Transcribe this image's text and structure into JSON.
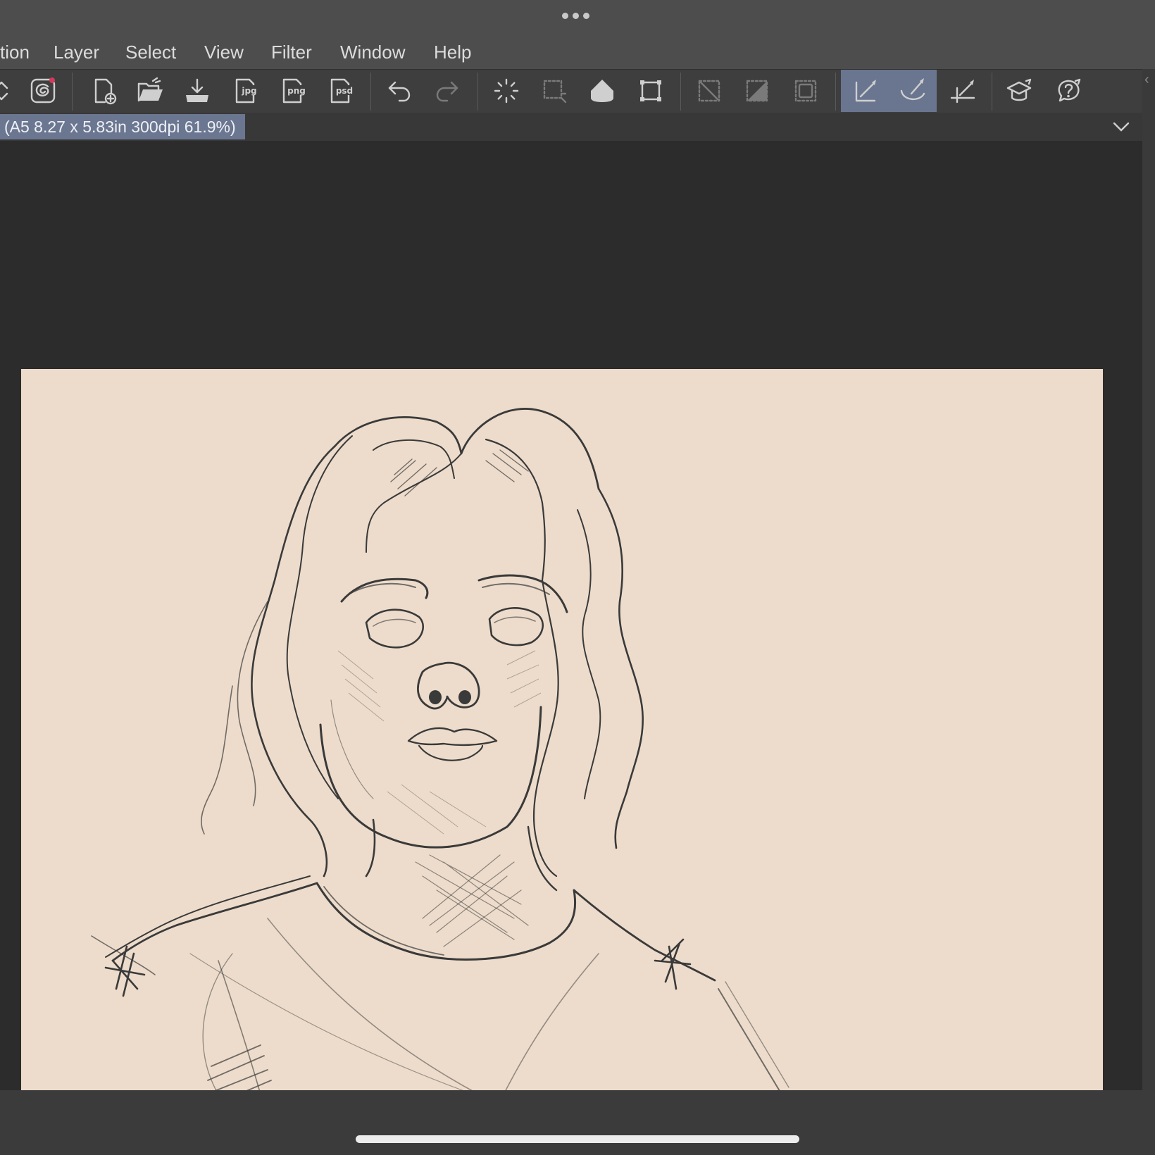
{
  "menu": {
    "items": [
      "tion",
      "Layer",
      "Select",
      "View",
      "Filter",
      "Window",
      "Help"
    ]
  },
  "toolbar": {
    "tools": [
      {
        "name": "scroll-arrows-icon",
        "state": "normal"
      },
      {
        "name": "app-logo-icon",
        "state": "normal",
        "has_notification_dot": true
      },
      {
        "name": "new-file-icon",
        "state": "normal"
      },
      {
        "name": "open-folder-icon",
        "state": "normal"
      },
      {
        "name": "save-icon",
        "state": "normal"
      },
      {
        "name": "export-jpg-icon",
        "state": "normal",
        "badge": "jpg"
      },
      {
        "name": "export-png-icon",
        "state": "normal",
        "badge": "png"
      },
      {
        "name": "export-psd-icon",
        "state": "normal",
        "badge": "psd"
      },
      {
        "name": "undo-icon",
        "state": "normal"
      },
      {
        "name": "redo-icon",
        "state": "disabled"
      },
      {
        "name": "loading-icon",
        "state": "normal"
      },
      {
        "name": "selection-icon",
        "state": "disabled"
      },
      {
        "name": "fill-bucket-icon",
        "state": "normal"
      },
      {
        "name": "transform-icon",
        "state": "normal"
      },
      {
        "name": "clear-selection-icon",
        "state": "disabled"
      },
      {
        "name": "invert-selection-icon",
        "state": "disabled"
      },
      {
        "name": "select-all-icon",
        "state": "disabled"
      },
      {
        "name": "snap-ruler-icon",
        "state": "active"
      },
      {
        "name": "snap-curve-icon",
        "state": "active"
      },
      {
        "name": "snap-grid-icon",
        "state": "normal"
      },
      {
        "name": "learn-icon",
        "state": "normal"
      },
      {
        "name": "help-icon",
        "state": "normal"
      }
    ]
  },
  "document": {
    "tab_label": "(A5 8.27 x 5.83in 300dpi 61.9%)"
  },
  "colors": {
    "chrome": "#4d4d4d",
    "toolbar": "#3e3e3e",
    "active_tool": "#6a7590",
    "workspace": "#2c2c2c",
    "canvas_paper": "#eddccb",
    "sketch_stroke": "#3a3a3a"
  }
}
